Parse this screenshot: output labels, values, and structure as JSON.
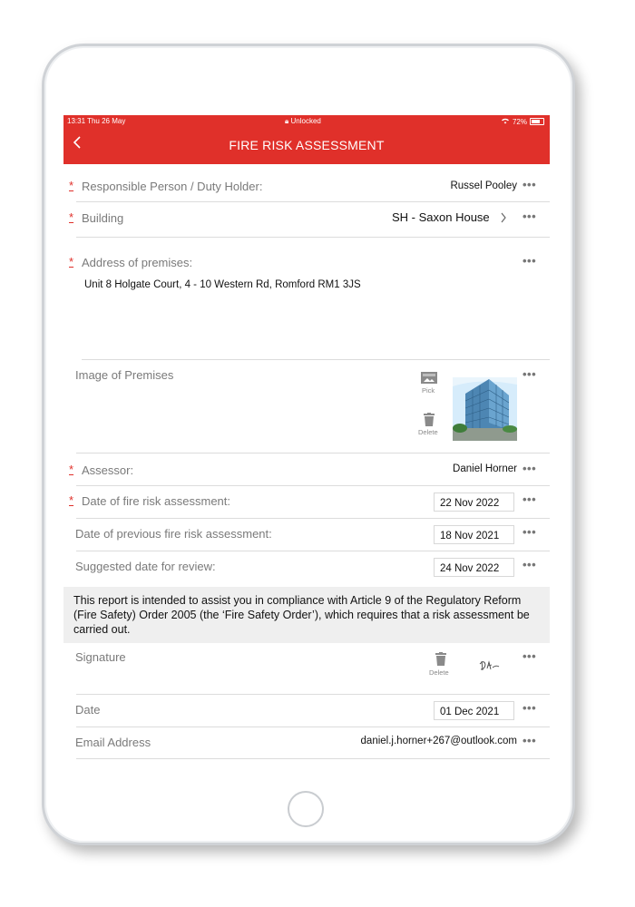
{
  "status": {
    "time": "13:31  Thu 26 May",
    "lock": "Unlocked",
    "battery": "72%"
  },
  "nav": {
    "back_icon": "chevron-left",
    "title": "FIRE RISK ASSESSMENT"
  },
  "fields": {
    "responsible_person": {
      "label": "Responsible Person / Duty Holder:",
      "value": "Russel Pooley",
      "required_mark": "*"
    },
    "building": {
      "label": "Building",
      "value": "SH - Saxon House",
      "required_mark": "*"
    },
    "address": {
      "label": "Address of premises:",
      "value": "Unit 8 Holgate Court, 4 - 10 Western Rd, Romford RM1 3JS",
      "required_mark": "*"
    },
    "image": {
      "label": "Image of Premises",
      "pick_label": "Pick",
      "delete_label": "Delete"
    },
    "assessor": {
      "label": "Assessor:",
      "value": "Daniel Horner",
      "required_mark": "*"
    },
    "date_assessment": {
      "label": "Date of fire risk assessment:",
      "value": "22 Nov 2022",
      "required_mark": "*"
    },
    "date_previous": {
      "label": "Date of previous fire risk assessment:",
      "value": "18 Nov 2021"
    },
    "date_review": {
      "label": "Suggested date for review:",
      "value": "24 Nov 2022"
    },
    "notice": "This report is intended to assist you in compliance with Article 9 of the Regulatory Reform (Fire Safety) Order 2005 (the ‘Fire Safety Order’), which requires that a risk assessment be carried out.",
    "signature": {
      "label": "Signature",
      "delete_label": "Delete"
    },
    "date": {
      "label": "Date",
      "value": "01 Dec 2021"
    },
    "email": {
      "label": "Email Address",
      "value": "daniel.j.horner+267@outlook.com"
    }
  },
  "more_icon": "•••",
  "colors": {
    "brand_red": "#e0302a"
  }
}
